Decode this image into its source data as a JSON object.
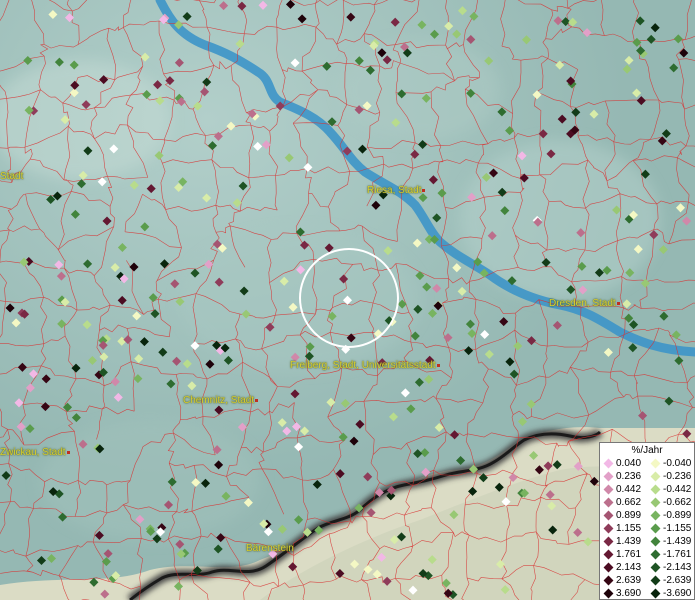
{
  "cities": [
    {
      "name": "Riesa, Stadt"
    },
    {
      "name": "Dresden, Stadt"
    },
    {
      "name": "Freiberg, Stadt, Universitätsstadt"
    },
    {
      "name": "Chemnitz, Stadt"
    },
    {
      "name": "Zwickau, Stadt"
    },
    {
      "name": "Bärenstein"
    },
    {
      "name": "Stadt"
    }
  ],
  "legend": {
    "unit": "%/Jahr",
    "positive": [
      {
        "value": "0.040",
        "color": "#f2b8e6"
      },
      {
        "value": "0.236",
        "color": "#e2a0c8"
      },
      {
        "value": "0.442",
        "color": "#d088a9"
      },
      {
        "value": "0.662",
        "color": "#bc6f8c"
      },
      {
        "value": "0.899",
        "color": "#a55572"
      },
      {
        "value": "1.155",
        "color": "#8f3c5a"
      },
      {
        "value": "1.439",
        "color": "#7a2844"
      },
      {
        "value": "1.761",
        "color": "#641832"
      },
      {
        "value": "2.143",
        "color": "#4c0c22"
      },
      {
        "value": "2.639",
        "color": "#360614"
      },
      {
        "value": "3.690",
        "color": "#1e020a"
      }
    ],
    "negative": [
      {
        "value": "-0.040",
        "color": "#f4f8c4"
      },
      {
        "value": "-0.236",
        "color": "#d8eca8"
      },
      {
        "value": "-0.442",
        "color": "#b8dc8c"
      },
      {
        "value": "-0.662",
        "color": "#98c874"
      },
      {
        "value": "-0.899",
        "color": "#78b460"
      },
      {
        "value": "-1.155",
        "color": "#5a9c4c"
      },
      {
        "value": "-1.439",
        "color": "#42843c"
      },
      {
        "value": "-1.761",
        "color": "#2e6c30"
      },
      {
        "value": "-2.143",
        "color": "#1e5424"
      },
      {
        "value": "-2.639",
        "color": "#123c18"
      },
      {
        "value": "-3.690",
        "color": "#08240c"
      }
    ]
  },
  "colors": {
    "border": "#d83030",
    "river": "#3d95c8",
    "terrain": "#9fc0bb",
    "station_white": "#ffffff"
  }
}
